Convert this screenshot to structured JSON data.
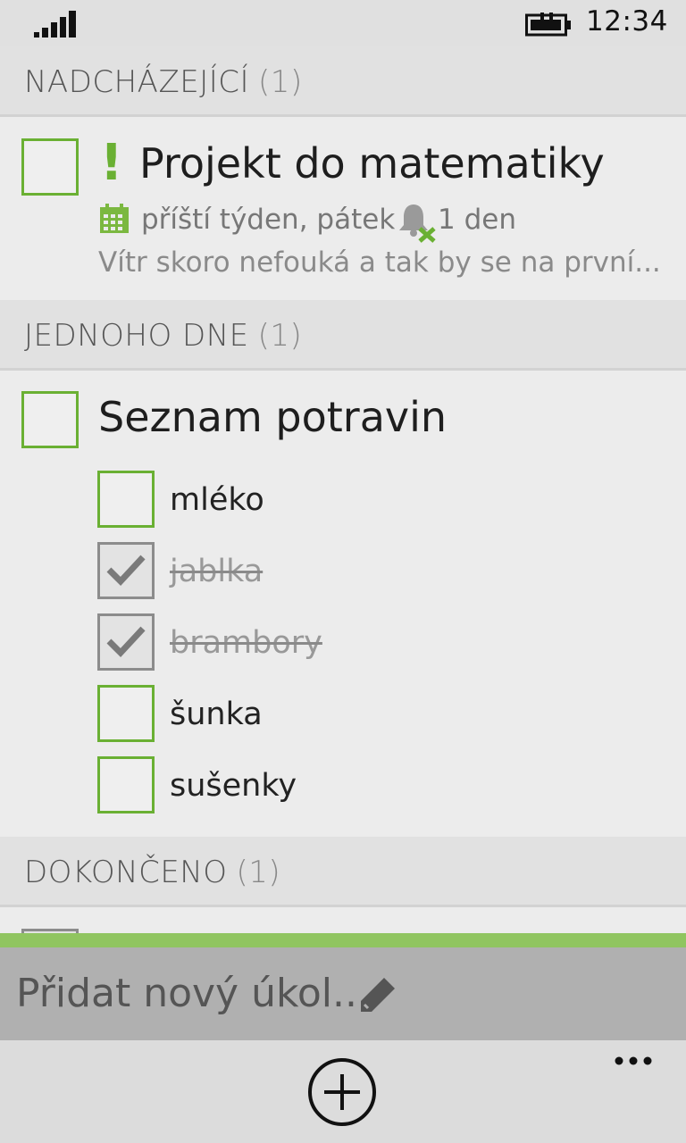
{
  "status": {
    "time": "12:34",
    "signal_icon": "signal-strength-icon",
    "battery_icon": "battery-charging-icon"
  },
  "sections": [
    {
      "title": "NADCHÁZEJÍCÍ",
      "count": "(1)"
    },
    {
      "title": "JEDNOHO DNE",
      "count": "(1)"
    },
    {
      "title": "DOKONČENO",
      "count": "(1)"
    }
  ],
  "upcoming_task": {
    "priority_mark": "!",
    "title": "Projekt do matematiky",
    "due": "příští týden, pátek",
    "reminder": "1 den",
    "note": "Vítr skoro nefouká a tak by se na první..."
  },
  "oneday_task": {
    "title": "Seznam potravin",
    "items": [
      {
        "label": "mléko",
        "done": false
      },
      {
        "label": "jablka",
        "done": true
      },
      {
        "label": "brambory",
        "done": true
      },
      {
        "label": "šunka",
        "done": false
      },
      {
        "label": "sušenky",
        "done": false
      }
    ]
  },
  "add_bar": {
    "placeholder": "Přidat nový úkol..."
  },
  "colors": {
    "accent": "#6ab033",
    "header_bg": "#e1e1e1",
    "add_bar_bg": "#b0b0b0",
    "green_strip": "#90c560"
  }
}
